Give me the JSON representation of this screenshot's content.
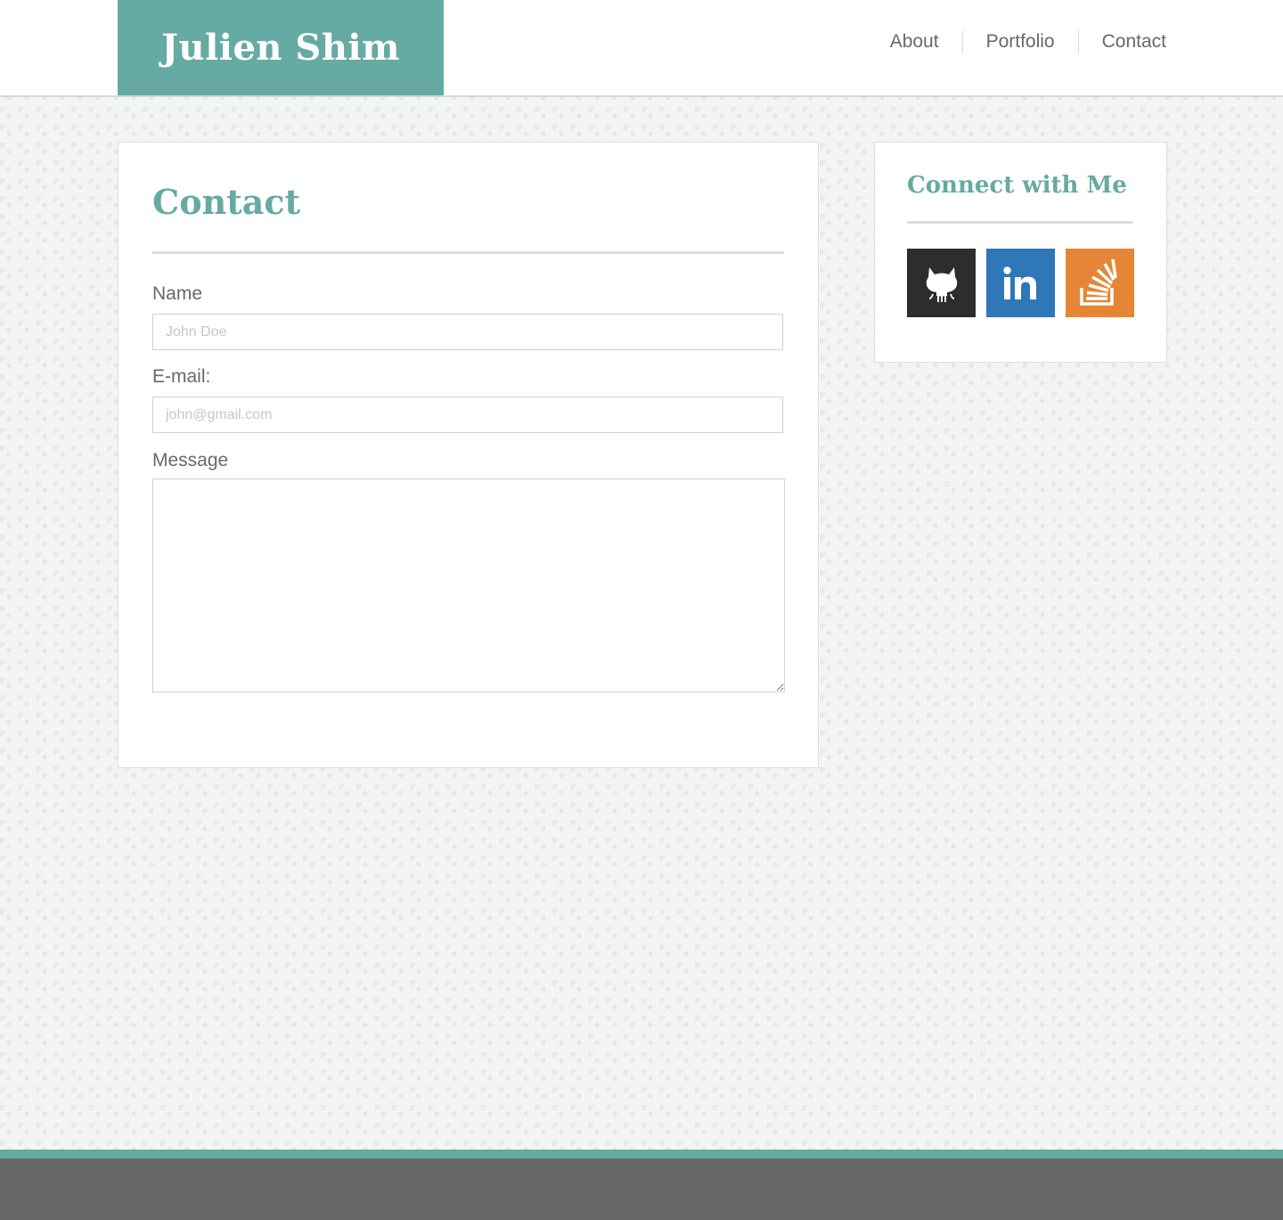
{
  "header": {
    "brand": "Julien Shim",
    "nav": [
      {
        "label": "About"
      },
      {
        "label": "Portfolio"
      },
      {
        "label": "Contact"
      }
    ]
  },
  "contact": {
    "title": "Contact",
    "name_label": "Name",
    "name_placeholder": "John Doe",
    "name_value": "",
    "email_label": "E-mail:",
    "email_placeholder": "john@gmail.com",
    "email_value": "",
    "message_label": "Message",
    "message_value": ""
  },
  "sidebar": {
    "title": "Connect with Me",
    "links": [
      {
        "icon": "github-icon",
        "color": "#2d2d2d"
      },
      {
        "icon": "linkedin-icon",
        "color": "#2f77b8"
      },
      {
        "icon": "stackoverflow-icon",
        "color": "#e58636"
      }
    ]
  },
  "colors": {
    "accent": "#65aaa3",
    "footer": "#676767",
    "text": "#666a6a"
  }
}
